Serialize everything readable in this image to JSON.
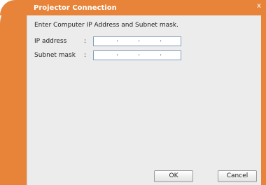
{
  "window": {
    "title": "Projector Connection",
    "close_glyph": "x"
  },
  "form": {
    "instruction": "Enter Computer IP Address and Subnet mask.",
    "ip_label": "IP address",
    "subnet_label": "Subnet mask",
    "colon": ":",
    "ip_segments": [
      "",
      "",
      "",
      ""
    ],
    "subnet_segments": [
      "",
      "",
      "",
      ""
    ],
    "separator": "."
  },
  "buttons": {
    "ok": "OK",
    "cancel": "Cancel"
  },
  "colors": {
    "frame": "#e8843a",
    "content_bg": "#ececec"
  }
}
